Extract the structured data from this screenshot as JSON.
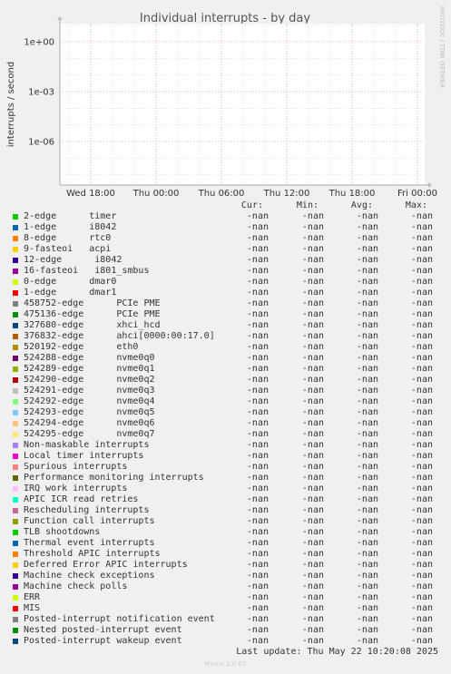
{
  "chart_data": {
    "type": "line",
    "title": "Individual interrupts - by day",
    "ylabel": "interrupts / second",
    "xlabel": "",
    "y_scale": "log",
    "y_ticks": [
      "1e+00",
      "1e-03",
      "1e-06"
    ],
    "x_ticks": [
      "Wed 18:00",
      "Thu 00:00",
      "Thu 06:00",
      "Thu 12:00",
      "Thu 18:00",
      "Fri 00:00"
    ],
    "grid": true,
    "side_label": "RRDTOOL / TOBI OETIKER",
    "series_values": "no data (-nan)"
  },
  "legend": {
    "headers": {
      "cur": "Cur:",
      "min": "Min:",
      "avg": "Avg:",
      "max": "Max:"
    },
    "rows": [
      {
        "name": "2-edge      timer",
        "color": "#00cc00",
        "cur": "-nan",
        "min": "-nan",
        "avg": "-nan",
        "max": "-nan"
      },
      {
        "name": "1-edge      i8042",
        "color": "#0066b3",
        "cur": "-nan",
        "min": "-nan",
        "avg": "-nan",
        "max": "-nan"
      },
      {
        "name": "8-edge      rtc0",
        "color": "#ff8000",
        "cur": "-nan",
        "min": "-nan",
        "avg": "-nan",
        "max": "-nan"
      },
      {
        "name": "9-fasteoi   acpi",
        "color": "#ffcc00",
        "cur": "-nan",
        "min": "-nan",
        "avg": "-nan",
        "max": "-nan"
      },
      {
        "name": "12-edge      i8042",
        "color": "#330099",
        "cur": "-nan",
        "min": "-nan",
        "avg": "-nan",
        "max": "-nan"
      },
      {
        "name": "16-fasteoi   i801_smbus",
        "color": "#990099",
        "cur": "-nan",
        "min": "-nan",
        "avg": "-nan",
        "max": "-nan"
      },
      {
        "name": "0-edge      dmar0",
        "color": "#ccff00",
        "cur": "-nan",
        "min": "-nan",
        "avg": "-nan",
        "max": "-nan"
      },
      {
        "name": "1-edge      dmar1",
        "color": "#ff0000",
        "cur": "-nan",
        "min": "-nan",
        "avg": "-nan",
        "max": "-nan"
      },
      {
        "name": "458752-edge      PCIe PME",
        "color": "#808080",
        "cur": "-nan",
        "min": "-nan",
        "avg": "-nan",
        "max": "-nan"
      },
      {
        "name": "475136-edge      PCIe PME",
        "color": "#008f00",
        "cur": "-nan",
        "min": "-nan",
        "avg": "-nan",
        "max": "-nan"
      },
      {
        "name": "327680-edge      xhci_hcd",
        "color": "#00487d",
        "cur": "-nan",
        "min": "-nan",
        "avg": "-nan",
        "max": "-nan"
      },
      {
        "name": "376832-edge      ahci[0000:00:17.0]",
        "color": "#b35a00",
        "cur": "-nan",
        "min": "-nan",
        "avg": "-nan",
        "max": "-nan"
      },
      {
        "name": "520192-edge      eth0",
        "color": "#b38f00",
        "cur": "-nan",
        "min": "-nan",
        "avg": "-nan",
        "max": "-nan"
      },
      {
        "name": "524288-edge      nvme0q0",
        "color": "#6b006b",
        "cur": "-nan",
        "min": "-nan",
        "avg": "-nan",
        "max": "-nan"
      },
      {
        "name": "524289-edge      nvme0q1",
        "color": "#8fb300",
        "cur": "-nan",
        "min": "-nan",
        "avg": "-nan",
        "max": "-nan"
      },
      {
        "name": "524290-edge      nvme0q2",
        "color": "#b30000",
        "cur": "-nan",
        "min": "-nan",
        "avg": "-nan",
        "max": "-nan"
      },
      {
        "name": "524291-edge      nvme0q3",
        "color": "#bebebe",
        "cur": "-nan",
        "min": "-nan",
        "avg": "-nan",
        "max": "-nan"
      },
      {
        "name": "524292-edge      nvme0q4",
        "color": "#80ff80",
        "cur": "-nan",
        "min": "-nan",
        "avg": "-nan",
        "max": "-nan"
      },
      {
        "name": "524293-edge      nvme0q5",
        "color": "#80c9ff",
        "cur": "-nan",
        "min": "-nan",
        "avg": "-nan",
        "max": "-nan"
      },
      {
        "name": "524294-edge      nvme0q6",
        "color": "#ffc080",
        "cur": "-nan",
        "min": "-nan",
        "avg": "-nan",
        "max": "-nan"
      },
      {
        "name": "524295-edge      nvme0q7",
        "color": "#ffe680",
        "cur": "-nan",
        "min": "-nan",
        "avg": "-nan",
        "max": "-nan"
      },
      {
        "name": "Non-maskable interrupts",
        "color": "#aa80ff",
        "cur": "-nan",
        "min": "-nan",
        "avg": "-nan",
        "max": "-nan"
      },
      {
        "name": "Local timer interrupts",
        "color": "#ee00cc",
        "cur": "-nan",
        "min": "-nan",
        "avg": "-nan",
        "max": "-nan"
      },
      {
        "name": "Spurious interrupts",
        "color": "#ff8080",
        "cur": "-nan",
        "min": "-nan",
        "avg": "-nan",
        "max": "-nan"
      },
      {
        "name": "Performance monitoring interrupts",
        "color": "#666600",
        "cur": "-nan",
        "min": "-nan",
        "avg": "-nan",
        "max": "-nan"
      },
      {
        "name": "IRQ work interrupts",
        "color": "#ffbfff",
        "cur": "-nan",
        "min": "-nan",
        "avg": "-nan",
        "max": "-nan"
      },
      {
        "name": "APIC ICR read retries",
        "color": "#00ffcc",
        "cur": "-nan",
        "min": "-nan",
        "avg": "-nan",
        "max": "-nan"
      },
      {
        "name": "Rescheduling interrupts",
        "color": "#cc6699",
        "cur": "-nan",
        "min": "-nan",
        "avg": "-nan",
        "max": "-nan"
      },
      {
        "name": "Function call interrupts",
        "color": "#999900",
        "cur": "-nan",
        "min": "-nan",
        "avg": "-nan",
        "max": "-nan"
      },
      {
        "name": "TLB shootdowns",
        "color": "#00cc00",
        "cur": "-nan",
        "min": "-nan",
        "avg": "-nan",
        "max": "-nan"
      },
      {
        "name": "Thermal event interrupts",
        "color": "#0066b3",
        "cur": "-nan",
        "min": "-nan",
        "avg": "-nan",
        "max": "-nan"
      },
      {
        "name": "Threshold APIC interrupts",
        "color": "#ff8000",
        "cur": "-nan",
        "min": "-nan",
        "avg": "-nan",
        "max": "-nan"
      },
      {
        "name": "Deferred Error APIC interrupts",
        "color": "#ffcc00",
        "cur": "-nan",
        "min": "-nan",
        "avg": "-nan",
        "max": "-nan"
      },
      {
        "name": "Machine check exceptions",
        "color": "#330099",
        "cur": "-nan",
        "min": "-nan",
        "avg": "-nan",
        "max": "-nan"
      },
      {
        "name": "Machine check polls",
        "color": "#990099",
        "cur": "-nan",
        "min": "-nan",
        "avg": "-nan",
        "max": "-nan"
      },
      {
        "name": "ERR",
        "color": "#ccff00",
        "cur": "-nan",
        "min": "-nan",
        "avg": "-nan",
        "max": "-nan"
      },
      {
        "name": "MIS",
        "color": "#ff0000",
        "cur": "-nan",
        "min": "-nan",
        "avg": "-nan",
        "max": "-nan"
      },
      {
        "name": "Posted-interrupt notification event",
        "color": "#808080",
        "cur": "-nan",
        "min": "-nan",
        "avg": "-nan",
        "max": "-nan"
      },
      {
        "name": "Nested posted-interrupt event",
        "color": "#008f00",
        "cur": "-nan",
        "min": "-nan",
        "avg": "-nan",
        "max": "-nan"
      },
      {
        "name": "Posted-interrupt wakeup event",
        "color": "#00487d",
        "cur": "-nan",
        "min": "-nan",
        "avg": "-nan",
        "max": "-nan"
      }
    ]
  },
  "footer": {
    "last_update": "Last update: Thu May 22 10:20:08 2025",
    "munin": "Munin 2.0.67"
  }
}
